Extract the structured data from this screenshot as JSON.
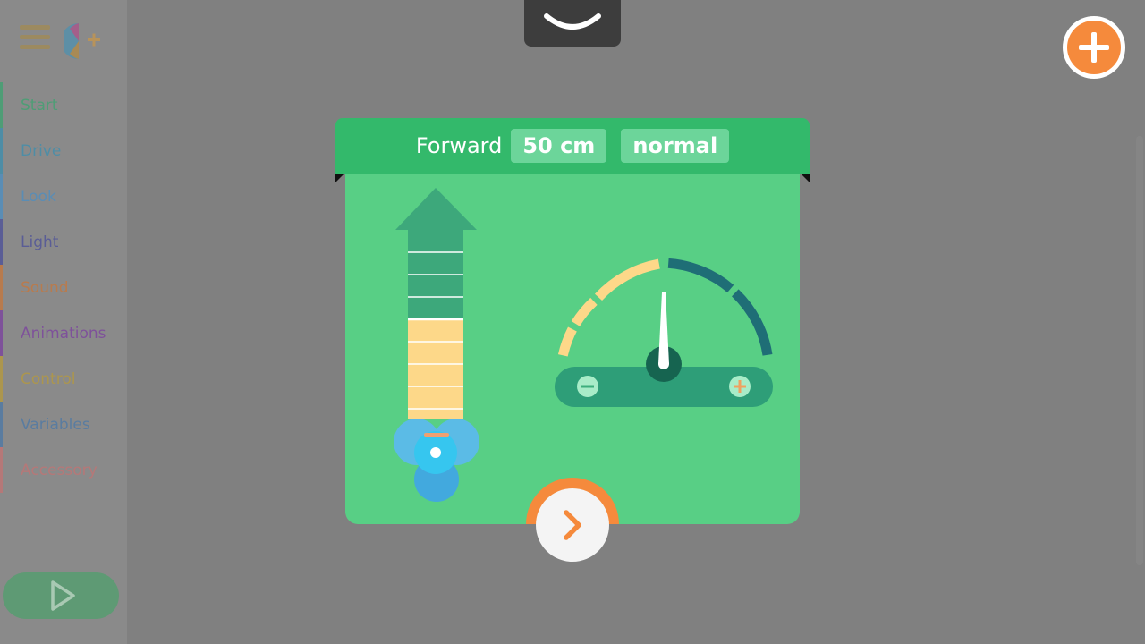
{
  "sidebar": {
    "categories": [
      {
        "label": "Start",
        "color": "#3ca470"
      },
      {
        "label": "Drive",
        "color": "#3a8fb0"
      },
      {
        "label": "Look",
        "color": "#4a8ec4"
      },
      {
        "label": "Light",
        "color": "#4b4f9a"
      },
      {
        "label": "Sound",
        "color": "#c8773a"
      },
      {
        "label": "Animations",
        "color": "#7b3fa0"
      },
      {
        "label": "Control",
        "color": "#b89a3a"
      },
      {
        "label": "Variables",
        "color": "#4a78a8"
      },
      {
        "label": "Accessory",
        "color": "#c47272"
      }
    ]
  },
  "block": {
    "command": "Forward",
    "distance": "50 cm",
    "speed": "normal",
    "distance_level_fraction": 0.5,
    "speedometer_level": "normal"
  },
  "icons": {
    "menu": "hamburger-menu-icon",
    "extensions": "add-extension-icon",
    "collapse": "chevron-down-icon",
    "add": "plus-icon",
    "play": "play-icon",
    "next": "chevron-right-icon",
    "robot": "robot-icon",
    "decrease": "minus-icon",
    "increase": "plus-icon"
  },
  "colors": {
    "accent": "#f58a3c",
    "block_green": "#58cf85",
    "header_green": "#33b96b",
    "yellow": "#fdd889",
    "dark_teal": "#1f6e76"
  }
}
